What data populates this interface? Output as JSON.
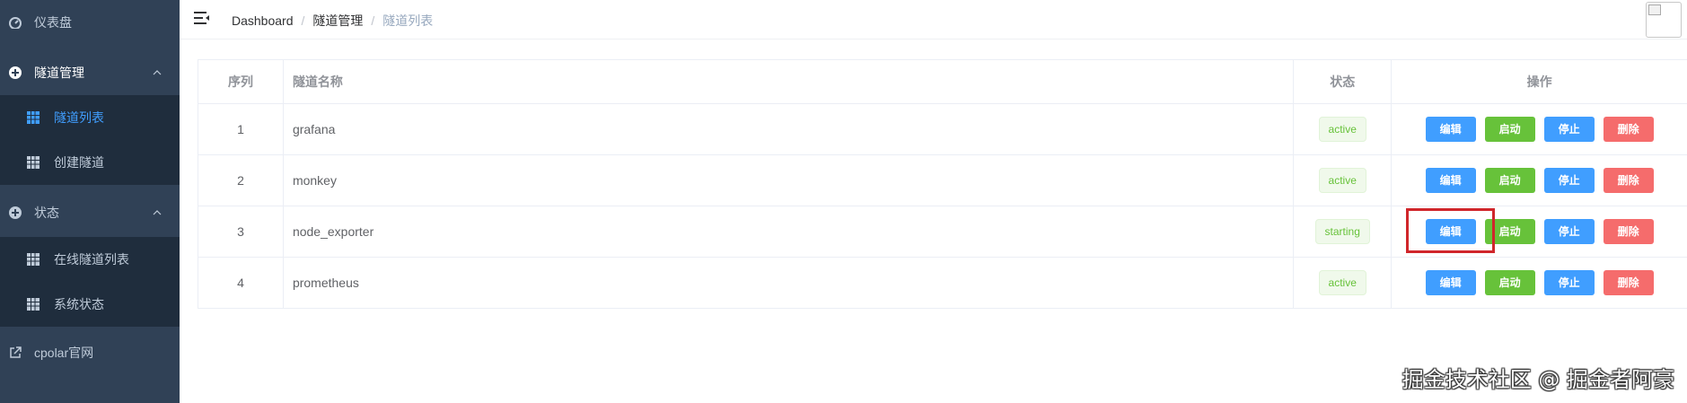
{
  "sidebar": {
    "dashboard": {
      "label": "仪表盘",
      "icon": "dashboard-icon"
    },
    "tunnel_mgmt": {
      "label": "隧道管理",
      "icon": "plus-circle-icon"
    },
    "tunnel_list": {
      "label": "隧道列表",
      "icon": "grid-icon"
    },
    "create_tunnel": {
      "label": "创建隧道",
      "icon": "grid-icon"
    },
    "status": {
      "label": "状态",
      "icon": "plus-circle-icon"
    },
    "online_tunnels": {
      "label": "在线隧道列表",
      "icon": "grid-icon"
    },
    "system_status": {
      "label": "系统状态",
      "icon": "grid-icon"
    },
    "cpolar_site": {
      "label": "cpolar官网",
      "icon": "external-link-icon"
    }
  },
  "breadcrumb": [
    "Dashboard",
    "隧道管理",
    "隧道列表"
  ],
  "breadcrumb_sep": "/",
  "table": {
    "headers": {
      "index": "序列",
      "name": "隧道名称",
      "status": "状态",
      "ops": "操作"
    },
    "rows": [
      {
        "index": "1",
        "name": "grafana",
        "status": "active"
      },
      {
        "index": "2",
        "name": "monkey",
        "status": "active"
      },
      {
        "index": "3",
        "name": "node_exporter",
        "status": "starting"
      },
      {
        "index": "4",
        "name": "prometheus",
        "status": "active"
      }
    ],
    "actions": {
      "edit": "编辑",
      "start": "启动",
      "stop": "停止",
      "delete": "删除"
    }
  },
  "watermark": "掘金技术社区 @ 掘金者阿豪",
  "colors": {
    "sidebar": "#304156",
    "submenu": "#1f2d3d",
    "primary": "#409eff",
    "success": "#67c23a",
    "danger": "#f56c6c",
    "highlight": "#d0262b"
  }
}
